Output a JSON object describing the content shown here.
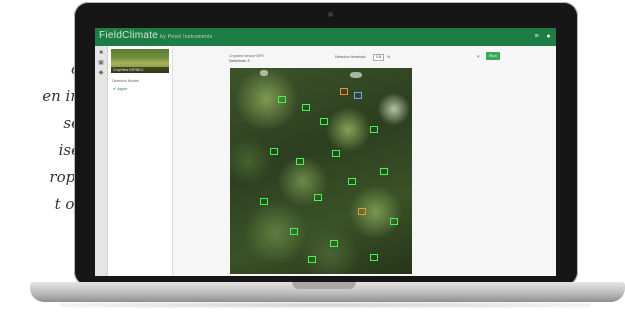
{
  "caption": {
    "lines": [
      "o",
      "en in",
      "se",
      "ise",
      "rop,",
      "t of"
    ]
  },
  "app": {
    "brand": "FieldClimate",
    "brand_sub": "by Pessl Instruments",
    "header_icons": [
      "menu-icon",
      "user-icon"
    ]
  },
  "rail": {
    "icons": [
      "home-icon",
      "camera-icon",
      "chart-icon"
    ]
  },
  "sidebar": {
    "thumbnail_label": "CropView 03F9BC1",
    "section_header": "Detection Models",
    "items": [
      {
        "label": "✔ Apple",
        "checked": true
      }
    ]
  },
  "main": {
    "info_line1": "Cropview device 03F9",
    "info_line2": "Detections: 3",
    "threshold_label": "Detection threshold:",
    "threshold_value": "0.8",
    "threshold_unit": "%",
    "select_arrow": "▾",
    "run_button": "Run"
  },
  "colors": {
    "brand_green": "#1e7c45",
    "detection_box": "#39ff4f",
    "button_green": "#3aa85a"
  }
}
